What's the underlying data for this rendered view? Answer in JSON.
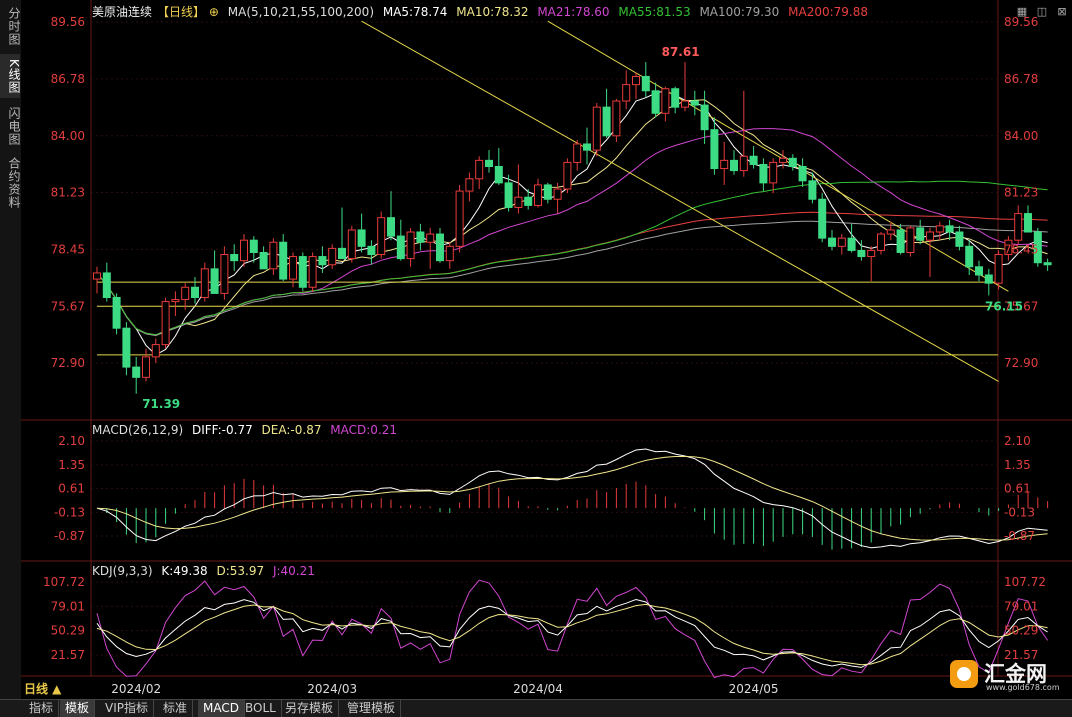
{
  "sidebar": {
    "tabs": [
      {
        "label": "分时图",
        "active": false
      },
      {
        "label": "K线图",
        "active": true
      },
      {
        "label": "闪电图",
        "active": false
      },
      {
        "label": "合约资料",
        "active": false
      }
    ]
  },
  "header": {
    "title": "美原油连续",
    "period_tag": "【日线】",
    "ma_params": "MA(5,10,21,55,100,200)",
    "ma5": "MA5:78.74",
    "ma10": "MA10:78.32",
    "ma21": "MA21:78.60",
    "ma55": "MA55:81.53",
    "ma100": "MA100:79.30",
    "ma200": "MA200:79.88"
  },
  "macd_legend": {
    "params": "MACD(26,12,9)",
    "diff": "DIFF:-0.77",
    "dea": "DEA:-0.87",
    "macd": "MACD:0.21"
  },
  "kdj_legend": {
    "params": "KDJ(9,3,3)",
    "k": "K:49.38",
    "d": "D:53.97",
    "j": "J:40.21"
  },
  "bottom_tabs": [
    "指标",
    "模板",
    "VIP指标",
    "标准",
    "MACD",
    "BOLL",
    "另存模板",
    "管理模板"
  ],
  "period_selector": "日线 ▲",
  "logo": {
    "name": "汇金网",
    "url": "www.gold678.com"
  },
  "colors": {
    "up": "#e83b3b",
    "down": "#3ddc84",
    "ma5": "#ffffff",
    "ma10": "#f0e68c",
    "ma21": "#d046d0",
    "ma55": "#33c233",
    "ma100": "#a0a0a0",
    "ma200": "#e84040",
    "trend": "#e6d84a",
    "axis_text": "#e23e3e",
    "grid": "#2a1414"
  },
  "chart_data": [
    {
      "type": "candlestick",
      "title": "美原油连续",
      "yaxis_ticks": [
        "89.56",
        "86.78",
        "84.00",
        "81.23",
        "78.45",
        "75.67",
        "72.90"
      ],
      "xaxis_ticks": [
        "2024/02",
        "2024/03",
        "2024/04",
        "2024/05"
      ],
      "annotations": [
        {
          "label": "87.61",
          "kind": "high"
        },
        {
          "label": "71.39",
          "kind": "low"
        },
        {
          "label": "76.15",
          "kind": "low"
        }
      ],
      "horizontal_lines": [
        76.85,
        75.67,
        73.3
      ],
      "ohlc": [
        [
          77.0,
          77.6,
          76.3,
          77.3
        ],
        [
          77.3,
          77.8,
          75.9,
          76.1
        ],
        [
          76.1,
          76.3,
          74.3,
          74.6
        ],
        [
          74.6,
          74.9,
          72.3,
          72.7
        ],
        [
          72.7,
          73.2,
          71.4,
          72.2
        ],
        [
          72.2,
          73.6,
          72.0,
          73.2
        ],
        [
          73.2,
          74.1,
          72.9,
          73.8
        ],
        [
          73.8,
          76.1,
          73.6,
          75.9
        ],
        [
          75.9,
          76.4,
          75.2,
          76.0
        ],
        [
          76.0,
          76.8,
          75.5,
          76.6
        ],
        [
          76.6,
          77.1,
          75.8,
          76.1
        ],
        [
          76.1,
          77.8,
          75.9,
          77.5
        ],
        [
          77.5,
          78.4,
          77.0,
          76.3
        ],
        [
          76.3,
          78.6,
          76.0,
          78.2
        ],
        [
          78.2,
          78.7,
          77.4,
          77.9
        ],
        [
          77.9,
          79.2,
          77.6,
          78.9
        ],
        [
          78.9,
          79.1,
          77.8,
          78.3
        ],
        [
          78.3,
          78.6,
          77.5,
          77.5
        ],
        [
          77.5,
          79.0,
          77.2,
          78.8
        ],
        [
          78.8,
          79.2,
          76.9,
          77.0
        ],
        [
          77.0,
          78.3,
          76.6,
          78.1
        ],
        [
          78.1,
          78.3,
          76.4,
          76.6
        ],
        [
          76.6,
          78.3,
          76.4,
          78.1
        ],
        [
          78.1,
          78.6,
          77.3,
          77.7
        ],
        [
          77.7,
          78.7,
          77.5,
          78.5
        ],
        [
          78.5,
          80.5,
          78.2,
          78.0
        ],
        [
          78.0,
          79.6,
          77.8,
          79.4
        ],
        [
          79.4,
          80.2,
          78.3,
          78.6
        ],
        [
          78.6,
          78.9,
          77.7,
          78.2
        ],
        [
          78.2,
          80.3,
          78.0,
          80.0
        ],
        [
          80.0,
          81.3,
          78.9,
          79.1
        ],
        [
          79.1,
          79.9,
          77.9,
          78.0
        ],
        [
          78.0,
          79.5,
          77.6,
          79.3
        ],
        [
          79.3,
          79.7,
          78.4,
          78.8
        ],
        [
          78.8,
          79.5,
          77.5,
          79.2
        ],
        [
          79.2,
          79.5,
          77.8,
          77.9
        ],
        [
          77.9,
          78.8,
          77.5,
          78.6
        ],
        [
          78.6,
          81.6,
          78.3,
          81.3
        ],
        [
          81.3,
          82.2,
          80.8,
          81.9
        ],
        [
          81.9,
          83.0,
          81.4,
          82.8
        ],
        [
          82.8,
          83.3,
          82.2,
          82.5
        ],
        [
          82.5,
          83.4,
          81.6,
          81.7
        ],
        [
          81.7,
          82.1,
          80.3,
          80.5
        ],
        [
          80.5,
          82.6,
          80.2,
          81.0
        ],
        [
          81.0,
          81.4,
          80.4,
          80.6
        ],
        [
          80.6,
          81.9,
          80.5,
          81.6
        ],
        [
          81.6,
          81.7,
          80.7,
          80.9
        ],
        [
          80.9,
          81.7,
          80.2,
          81.4
        ],
        [
          81.4,
          82.9,
          81.2,
          82.7
        ],
        [
          82.7,
          83.8,
          82.3,
          83.6
        ],
        [
          83.6,
          84.4,
          82.6,
          83.3
        ],
        [
          83.3,
          85.6,
          83.0,
          85.4
        ],
        [
          85.4,
          86.3,
          83.9,
          84.0
        ],
        [
          84.0,
          85.8,
          83.7,
          85.7
        ],
        [
          85.7,
          87.2,
          85.3,
          86.5
        ],
        [
          86.5,
          87.1,
          85.8,
          86.9
        ],
        [
          86.9,
          87.6,
          85.9,
          86.2
        ],
        [
          86.2,
          86.6,
          84.9,
          85.1
        ],
        [
          85.1,
          86.4,
          84.7,
          86.3
        ],
        [
          86.3,
          86.4,
          85.1,
          85.4
        ],
        [
          85.4,
          87.6,
          85.2,
          85.7
        ],
        [
          85.7,
          86.2,
          85.0,
          85.5
        ],
        [
          85.5,
          86.2,
          83.6,
          84.3
        ],
        [
          84.3,
          84.9,
          82.1,
          82.4
        ],
        [
          82.4,
          83.7,
          81.6,
          82.8
        ],
        [
          82.8,
          83.3,
          82.1,
          82.3
        ],
        [
          82.3,
          86.2,
          82.0,
          83.0
        ],
        [
          83.0,
          83.5,
          82.4,
          82.6
        ],
        [
          82.6,
          82.9,
          81.3,
          81.7
        ],
        [
          81.7,
          82.9,
          81.2,
          82.7
        ],
        [
          82.7,
          83.3,
          82.4,
          82.9
        ],
        [
          82.9,
          83.1,
          82.3,
          82.5
        ],
        [
          82.5,
          82.9,
          81.5,
          81.8
        ],
        [
          81.8,
          82.2,
          80.7,
          80.9
        ],
        [
          80.9,
          81.2,
          78.8,
          79.0
        ],
        [
          79.0,
          79.4,
          78.4,
          78.6
        ],
        [
          78.6,
          79.2,
          78.2,
          79.0
        ],
        [
          79.0,
          79.7,
          78.3,
          78.4
        ],
        [
          78.4,
          78.9,
          77.9,
          78.1
        ],
        [
          78.1,
          78.6,
          76.9,
          78.4
        ],
        [
          78.4,
          79.3,
          78.2,
          79.2
        ],
        [
          79.2,
          79.8,
          78.9,
          79.4
        ],
        [
          79.4,
          79.7,
          78.2,
          78.3
        ],
        [
          78.3,
          79.6,
          78.1,
          79.5
        ],
        [
          79.5,
          79.9,
          78.7,
          78.9
        ],
        [
          78.9,
          79.5,
          77.1,
          79.3
        ],
        [
          79.3,
          79.8,
          78.9,
          79.6
        ],
        [
          79.6,
          79.9,
          78.9,
          79.3
        ],
        [
          79.3,
          79.6,
          78.4,
          78.6
        ],
        [
          78.6,
          78.9,
          77.2,
          77.6
        ],
        [
          77.6,
          77.9,
          76.9,
          77.2
        ],
        [
          77.2,
          77.5,
          76.2,
          76.8
        ],
        [
          76.8,
          78.4,
          76.5,
          78.2
        ],
        [
          78.2,
          79.1,
          77.9,
          78.9
        ],
        [
          78.9,
          80.6,
          78.7,
          80.2
        ],
        [
          80.2,
          80.6,
          79.4,
          79.3
        ],
        [
          79.3,
          79.5,
          77.6,
          77.8
        ],
        [
          77.8,
          78.0,
          77.4,
          77.7
        ]
      ],
      "ma_last_values": {
        "MA5": 78.74,
        "MA10": 78.32,
        "MA21": 78.6,
        "MA55": 81.53,
        "MA100": 79.3,
        "MA200": 79.88
      }
    },
    {
      "type": "macd",
      "params": "MACD(26,12,9)",
      "yaxis_ticks": [
        "2.10",
        "1.35",
        "0.61",
        "-0.13",
        "-0.87"
      ],
      "last": {
        "DIFF": -0.77,
        "DEA": -0.87,
        "MACD": 0.21
      }
    },
    {
      "type": "kdj",
      "params": "KDJ(9,3,3)",
      "yaxis_ticks": [
        "107.72",
        "79.01",
        "50.29",
        "21.57"
      ],
      "last": {
        "K": 49.38,
        "D": 53.97,
        "J": 40.21
      }
    }
  ]
}
